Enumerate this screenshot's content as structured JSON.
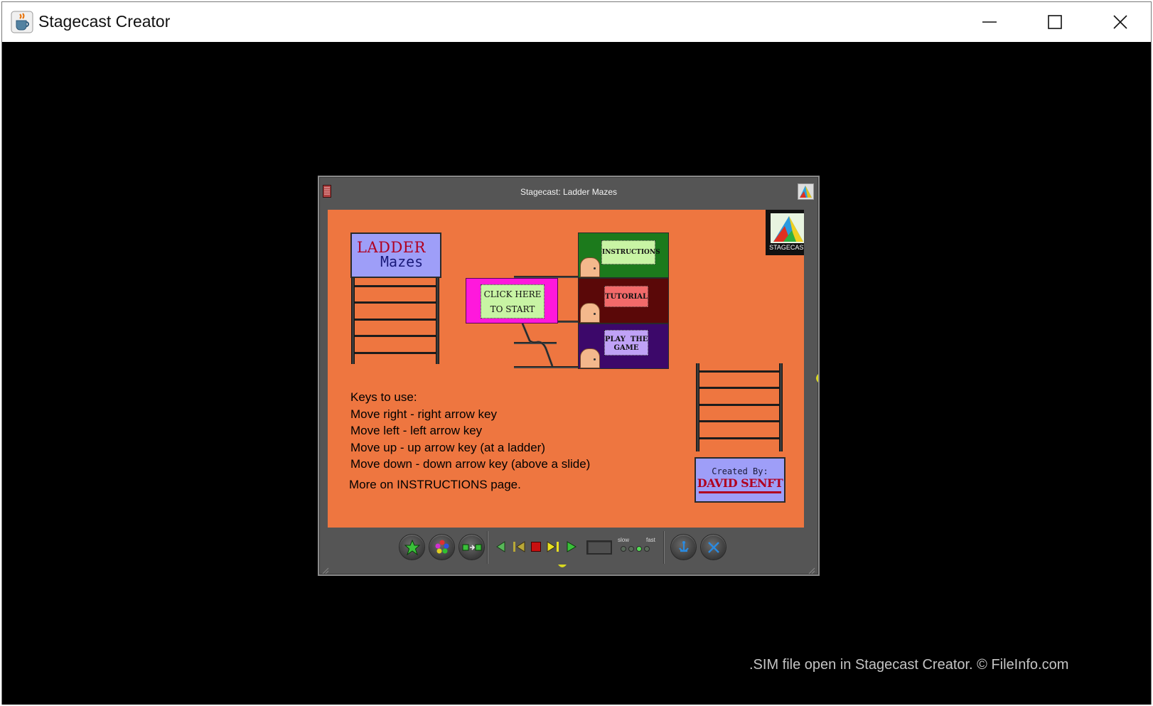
{
  "app": {
    "title": "Stagecast Creator",
    "icon": "java-cup-icon"
  },
  "window_controls": [
    "minimize-icon",
    "maximize-icon",
    "close-icon"
  ],
  "simulation": {
    "window_title": "Stagecast: Ladder Mazes",
    "stage": {
      "sign": {
        "line1": "LADDER",
        "line2": "Mazes"
      },
      "menu": {
        "instructions": "INSTRUCTIONS",
        "tutorial": "TUTORIAL",
        "play_line1": "PLAY  THE",
        "play_line2": "GAME"
      },
      "start": {
        "line1": "CLICK HERE",
        "line2": "TO START"
      },
      "logo_text": "STAGECAST",
      "keys": {
        "heading": "Keys to use:",
        "right": "Move right - right arrow key",
        "left": "Move left - left arrow key",
        "up": "Move up - up arrow key (at a ladder)",
        "down": "Move down - down arrow key (above a slide)"
      },
      "more": "More on INSTRUCTIONS page.",
      "credit": {
        "label": "Created By:",
        "name": "DAVID SENFT"
      }
    },
    "controls": {
      "speed_slow": "slow",
      "speed_fast": "fast",
      "speed_level": 3,
      "speed_levels": 4
    }
  },
  "colors": {
    "stage_bg": "#ee7640",
    "panel_bg": "#555555",
    "sign_bg": "#9e9ef8",
    "start_bg": "#ff18dc",
    "instructions_block": "#1c7a1c",
    "tutorial_block": "#5a0808",
    "play_block": "#3c086a"
  },
  "footer": ".SIM file open in Stagecast Creator. © FileInfo.com"
}
